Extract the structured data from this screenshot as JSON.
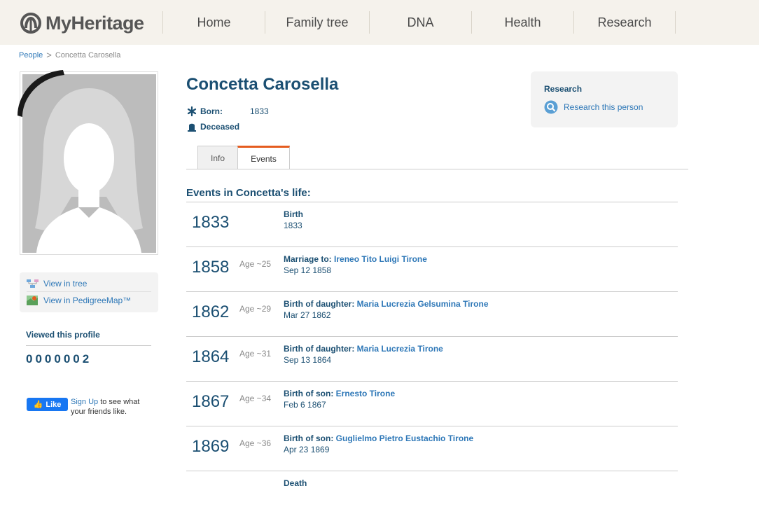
{
  "header": {
    "logo_text": "MyHeritage",
    "nav": [
      "Home",
      "Family tree",
      "DNA",
      "Health",
      "Research"
    ]
  },
  "breadcrumb": {
    "parent": "People",
    "separator": ">",
    "current": "Concetta Carosella"
  },
  "profile": {
    "name": "Concetta Carosella",
    "born_label": "Born:",
    "born_value": "1833",
    "deceased_label": "Deceased"
  },
  "side_links": {
    "view_in_tree": "View in tree",
    "view_in_pedigreemap": "View in PedigreeMap™"
  },
  "viewed": {
    "title": "Viewed this profile",
    "count": "0000002"
  },
  "facebook": {
    "like_label": "Like",
    "signup_label": "Sign Up",
    "text": "to see what your friends like."
  },
  "research_box": {
    "title": "Research",
    "link": "Research this person"
  },
  "tabs": [
    "Info",
    "Events"
  ],
  "events_heading": "Events in Concetta's life:",
  "events": [
    {
      "year": "1833",
      "age": "",
      "type": "Birth",
      "person": "",
      "date": "1833"
    },
    {
      "year": "1858",
      "age": "Age ~25",
      "type": "Marriage to:",
      "person": "Ireneo Tito Luigi Tirone",
      "date": "Sep 12 1858"
    },
    {
      "year": "1862",
      "age": "Age ~29",
      "type": "Birth of daughter:",
      "person": "Maria Lucrezia Gelsumina Tirone",
      "date": "Mar 27 1862"
    },
    {
      "year": "1864",
      "age": "Age ~31",
      "type": "Birth of daughter:",
      "person": "Maria Lucrezia Tirone",
      "date": "Sep 13 1864"
    },
    {
      "year": "1867",
      "age": "Age ~34",
      "type": "Birth of son:",
      "person": "Ernesto Tirone",
      "date": "Feb 6 1867"
    },
    {
      "year": "1869",
      "age": "Age ~36",
      "type": "Birth of son:",
      "person": "Guglielmo Pietro Eustachio Tirone",
      "date": "Apr 23 1869"
    },
    {
      "year": "",
      "age": "",
      "type": "Death",
      "person": "",
      "date": ""
    }
  ],
  "colors": {
    "header_bg": "#f5f2ec",
    "name_blue": "#1b4f72",
    "link_blue": "#2d77b7",
    "active_tab_accent": "#e55c1f"
  }
}
